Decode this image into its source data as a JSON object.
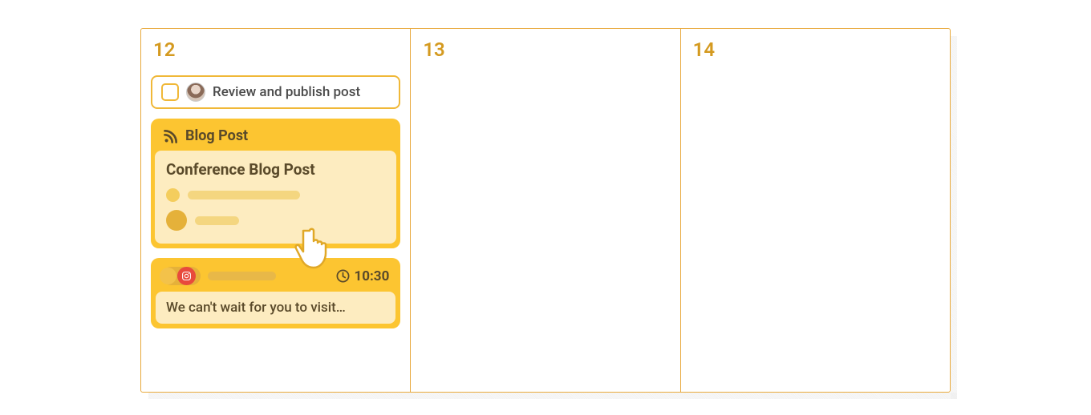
{
  "calendar": {
    "days": [
      {
        "number": "12"
      },
      {
        "number": "13"
      },
      {
        "number": "14"
      }
    ]
  },
  "task": {
    "label": "Review and publish post"
  },
  "blog": {
    "type_label": "Blog Post",
    "title": "Conference Blog Post"
  },
  "social": {
    "time": "10:30",
    "preview_text": "We can't wait for you to visit…"
  },
  "colors": {
    "accent": "#fcc531",
    "border": "#e8a93c"
  }
}
